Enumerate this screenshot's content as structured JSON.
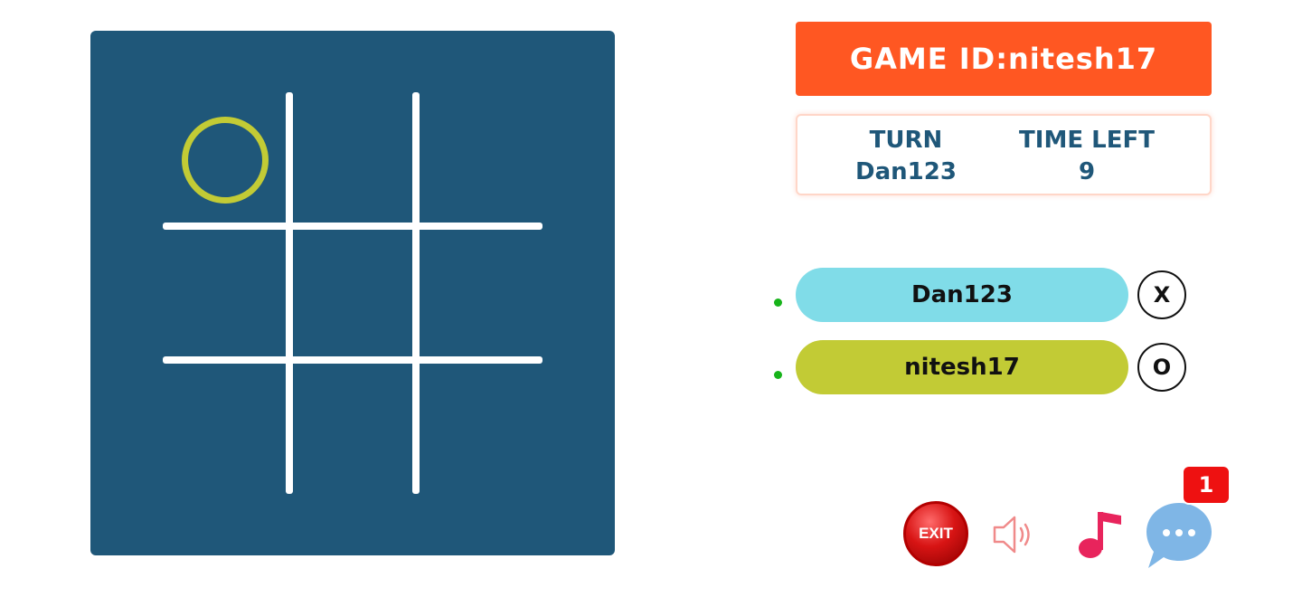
{
  "header": {
    "game_id_label": "GAME ID:nitesh17"
  },
  "status": {
    "turn_label": "TURN",
    "turn_value": "Dan123",
    "time_label": "TIME LEFT",
    "time_value": "9"
  },
  "players": [
    {
      "name": "Dan123",
      "symbol": "X",
      "color": "#80dce8",
      "online": true
    },
    {
      "name": "nitesh17",
      "symbol": "O",
      "color": "#c2cb35",
      "online": true
    }
  ],
  "board": {
    "background": "#1f5779",
    "cells": [
      "O",
      "",
      "",
      "",
      "",
      "",
      "",
      "",
      ""
    ],
    "o_color": "#c2cb35"
  },
  "controls": {
    "exit_label": "EXIT",
    "sound_icon": "speaker-icon",
    "music_icon": "music-note-icon",
    "chat_icon": "chat-bubble-icon",
    "chat_badge": "1"
  },
  "colors": {
    "accent": "#ff5722",
    "text_primary": "#1f5779",
    "online": "#17b31a"
  }
}
